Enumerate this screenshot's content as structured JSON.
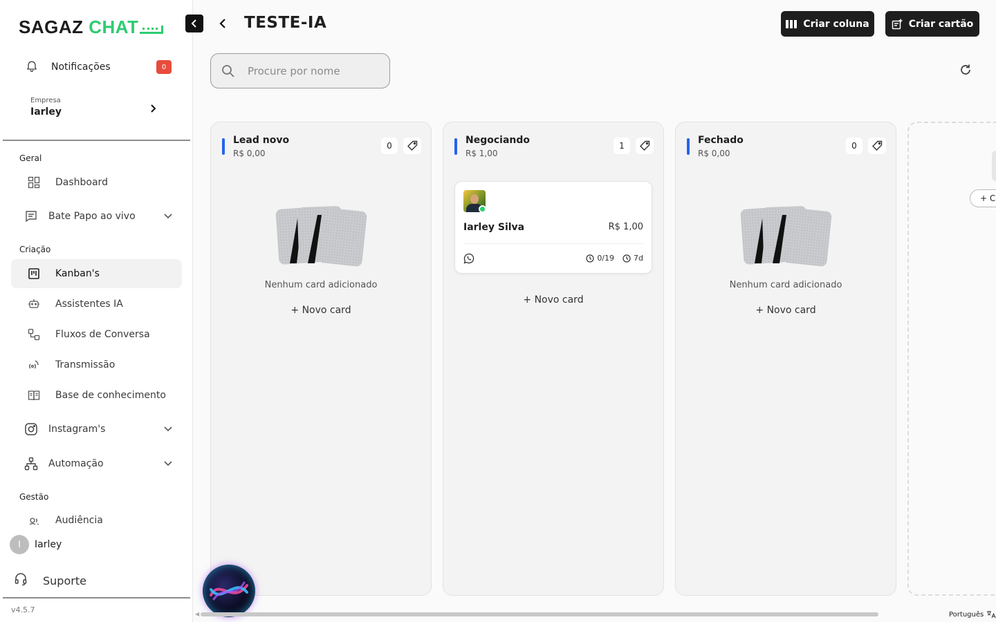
{
  "brand": {
    "part1": "SAGAZ",
    "part2": "CHAT"
  },
  "sidebar": {
    "notifications": {
      "label": "Notificações",
      "count": "0"
    },
    "company": {
      "caption": "Empresa",
      "name": "Iarley"
    },
    "sections": {
      "geral": "Geral",
      "criacao": "Criação",
      "gestao": "Gestão"
    },
    "items": {
      "dashboard": "Dashboard",
      "bate_papo": "Bate Papo ao vivo",
      "kanbans": "Kanban's",
      "assistentes": "Assistentes IA",
      "fluxos": "Fluxos de Conversa",
      "transmissao": "Transmissão",
      "base": "Base de conhecimento",
      "instagram": "Instagram's",
      "automacao": "Automação",
      "audiencia": "Audiência"
    },
    "user": {
      "initial": "I",
      "name": "Iarley"
    },
    "support": "Suporte",
    "version": "v4.5.7"
  },
  "header": {
    "title": "TESTE-IA",
    "create_column": "Criar coluna",
    "create_card": "Criar cartão"
  },
  "search": {
    "placeholder": "Procure por nome"
  },
  "board": {
    "columns": [
      {
        "name": "Lead novo",
        "value": "R$ 0,00",
        "count": "0",
        "empty_message": "Nenhum card adicionado",
        "new_card": "+ Novo card"
      },
      {
        "name": "Negociando",
        "value": "R$ 1,00",
        "count": "1",
        "new_card": "+ Novo card",
        "card": {
          "name": "Iarley Silva",
          "value": "R$ 1,00",
          "progress": "0/19",
          "age": "7d"
        }
      },
      {
        "name": "Fechado",
        "value": "R$ 0,00",
        "count": "0",
        "empty_message": "Nenhum card adicionado",
        "new_card": "+ Novo card"
      }
    ],
    "ghost_button": "+ Cr"
  },
  "footer": {
    "language": "Português"
  },
  "colors": {
    "accent_bar": "#2563eb",
    "brand_green": "#2ecc71",
    "badge_red": "#e74c3c",
    "dark_button": "#1e1e1e"
  }
}
